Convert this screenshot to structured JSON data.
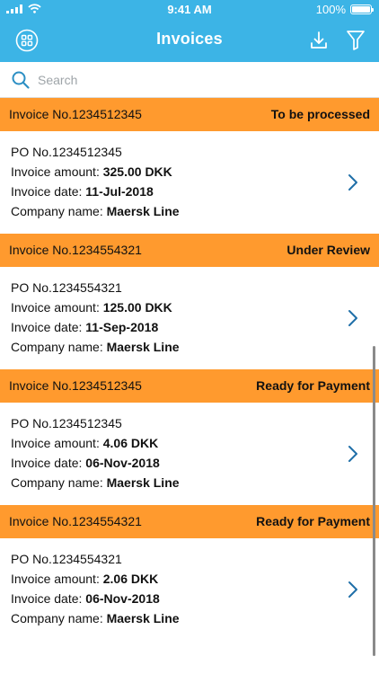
{
  "status_bar": {
    "time": "9:41 AM",
    "battery": "100%"
  },
  "nav": {
    "title": "Invoices",
    "apps_icon": "apps-grid-icon",
    "download_icon": "download-icon",
    "filter_icon": "filter-icon"
  },
  "search": {
    "placeholder": "Search",
    "value": ""
  },
  "labels": {
    "invoice_no": "Invoice No.",
    "po_no": "PO No.",
    "invoice_amount": "Invoice amount: ",
    "invoice_date": "Invoice date: ",
    "company_name": "Company name: "
  },
  "invoices": [
    {
      "invoice_no": "1234512345",
      "status": "To be processed",
      "po_no": "1234512345",
      "amount": "325.00 DKK",
      "date": "11-Jul-2018",
      "company": "Maersk Line"
    },
    {
      "invoice_no": "1234554321",
      "status": "Under Review",
      "po_no": "1234554321",
      "amount": "125.00 DKK",
      "date": "11-Sep-2018",
      "company": "Maersk Line"
    },
    {
      "invoice_no": "1234512345",
      "status": "Ready for Payment",
      "po_no": "1234512345",
      "amount": "4.06 DKK",
      "date": "06-Nov-2018",
      "company": "Maersk Line"
    },
    {
      "invoice_no": "1234554321",
      "status": "Ready for Payment",
      "po_no": "1234554321",
      "amount": "2.06 DKK",
      "date": "06-Nov-2018",
      "company": "Maersk Line"
    }
  ],
  "colors": {
    "nav_bg": "#3cb4e6",
    "invoice_header_bg": "#ff9a2e",
    "chevron": "#1f6fa8"
  }
}
